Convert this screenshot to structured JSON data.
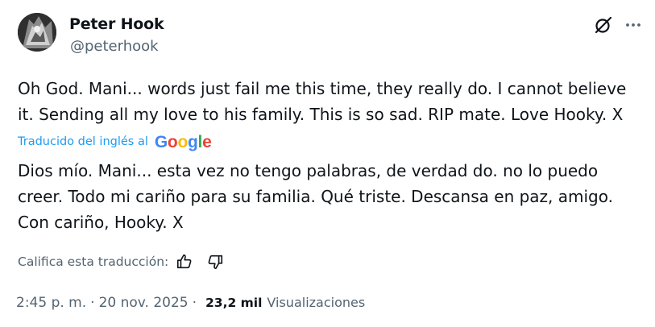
{
  "author": {
    "name": "Peter Hook",
    "handle": "@peterhook",
    "avatar_icon": "avatar-photo"
  },
  "header_actions": {
    "grok_icon": "grok-icon",
    "more_icon": "more-icon"
  },
  "tweet": {
    "text": "Oh God. Mani... words just fail me this time, they really do. I cannot believe it. Sending all my love to his family. This is so sad. RIP mate. Love Hooky. X"
  },
  "translation": {
    "label": "Traducido del inglés al",
    "provider": "Google",
    "provider_colors": [
      "#4285F4",
      "#EA4335",
      "#FBBC05",
      "#4285F4",
      "#34A853",
      "#EA4335"
    ],
    "text": "Dios mío. Mani... esta vez no tengo palabras, de verdad do. no lo puedo creer. Todo mi cariño para su familia. Qué triste. Descansa en paz, amigo. Con cariño, Hooky. X",
    "rate_label": "Califica esta traducción:"
  },
  "meta": {
    "time": "2:45 p. m.",
    "separator": "·",
    "date": "20 nov. 2025",
    "views_count": "23,2 mil",
    "views_label": "Visualizaciones"
  },
  "colors": {
    "text": "#0f1419",
    "secondary": "#536471",
    "link": "#1d9bf0"
  }
}
